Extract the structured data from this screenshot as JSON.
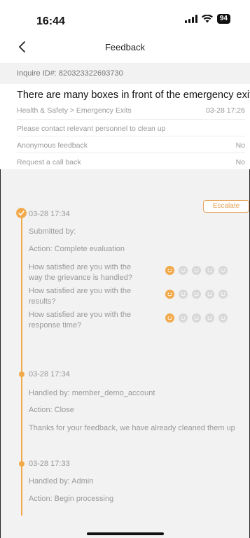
{
  "status_bar": {
    "time": "16:44",
    "battery": "94"
  },
  "nav": {
    "title": "Feedback"
  },
  "inquire_id": "Inquire ID#: 820323322693730",
  "details": {
    "title": "There are many boxes in front of the emergency exit",
    "category": "Health & Safety > Emergency Exits",
    "date": "03-28 17:26",
    "description": "Please contact relevant personnel to clean up",
    "anonymous_label": "Anonymous feedback",
    "anonymous_value": "No",
    "callback_label": "Request a call back",
    "callback_value": "No"
  },
  "escalate_label": "Escalate",
  "timeline": [
    {
      "time": "03-28 17:34",
      "by": "Submitted by:",
      "action": "Action: Complete evaluation",
      "ratings": [
        {
          "question": "How satisfied are you with the way the grievance is handled?",
          "value": 1,
          "max": 5
        },
        {
          "question": "How satisfied are you with the results?",
          "value": 1,
          "max": 5
        },
        {
          "question": "How satisfied are you with the response time?",
          "value": 1,
          "max": 5
        }
      ]
    },
    {
      "time": "03-28 17:34",
      "by": "Handled by: member_demo_account",
      "action": "Action: Close",
      "note": "Thanks for your feedback, we have already cleaned them up"
    },
    {
      "time": "03-28 17:33",
      "by": "Handled by: Admin",
      "action": "Action: Begin processing"
    }
  ],
  "colors": {
    "accent": "#f2a94a",
    "face_inactive": "#d8d8d8"
  }
}
